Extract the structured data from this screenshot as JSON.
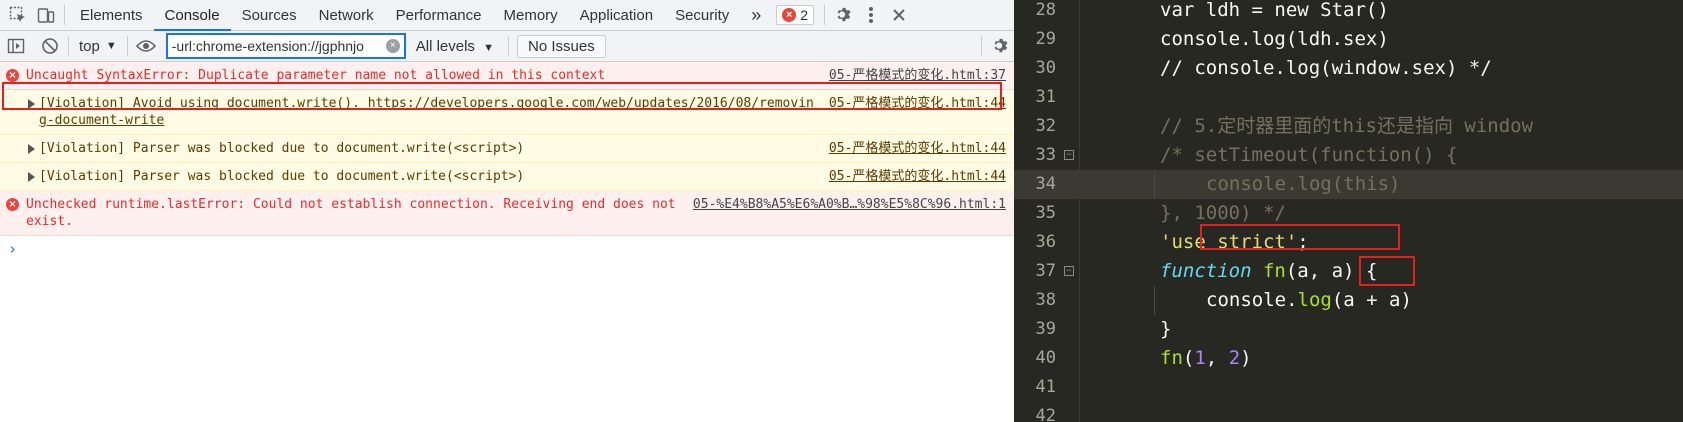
{
  "devtools": {
    "tabs": [
      "Elements",
      "Console",
      "Sources",
      "Network",
      "Performance",
      "Memory",
      "Application",
      "Security"
    ],
    "active_tab": "Console",
    "more_tabs": "»",
    "error_count": "2",
    "context": "top",
    "filter_value": "-url:chrome-extension://jgphnjo",
    "levels": "All levels",
    "issues": "No Issues",
    "messages": [
      {
        "type": "error",
        "text": "Uncaught SyntaxError: Duplicate parameter name not allowed in this context",
        "source": "05-严格模式的变化.html:37"
      },
      {
        "type": "warn",
        "text_prefix": "[Violation] Avoid using document.write(). ",
        "link": "https://developers.google.com/web/updates/2016/08/removing-document-write",
        "source": "05-严格模式的变化.html:44"
      },
      {
        "type": "warn",
        "text": "[Violation] Parser was blocked due to document.write(<script>)",
        "source": "05-严格模式的变化.html:44"
      },
      {
        "type": "warn",
        "text": "[Violation] Parser was blocked due to document.write(<script>)",
        "source": "05-严格模式的变化.html:44"
      },
      {
        "type": "error",
        "text": "Unchecked runtime.lastError: Could not establish connection. Receiving end does not exist.",
        "source": "05-%E4%B8%A5%E6%A0%B…%98%E5%8C%96.html:1"
      }
    ],
    "prompt": "›"
  },
  "editor": {
    "lines": [
      {
        "n": "28",
        "fold": false,
        "indent": 1,
        "tokens": [
          [
            "plain",
            "var ldh = new Star()"
          ]
        ]
      },
      {
        "n": "29",
        "fold": false,
        "indent": 1,
        "tokens": [
          [
            "plain",
            "console.log(ldh.sex)"
          ]
        ]
      },
      {
        "n": "30",
        "fold": false,
        "indent": 1,
        "tokens": [
          [
            "plain",
            "// console.log(window.sex) */"
          ]
        ]
      },
      {
        "n": "31",
        "fold": false,
        "indent": 0,
        "tokens": []
      },
      {
        "n": "32",
        "fold": false,
        "indent": 1,
        "tokens": [
          [
            "cm",
            "// 5.定时器里面的this还是指向 window"
          ]
        ]
      },
      {
        "n": "33",
        "fold": true,
        "indent": 1,
        "tokens": [
          [
            "cm",
            "/* setTimeout(function() {"
          ]
        ]
      },
      {
        "n": "34",
        "fold": false,
        "indent": 2,
        "tokens": [
          [
            "cm",
            "console.log(this)"
          ]
        ]
      },
      {
        "n": "35",
        "fold": false,
        "indent": 1,
        "tokens": [
          [
            "cm",
            "}, 1000) */"
          ]
        ]
      },
      {
        "n": "36",
        "fold": false,
        "indent": 1,
        "tokens": [
          [
            "str",
            "'use strict'"
          ],
          [
            "plain",
            ";"
          ]
        ]
      },
      {
        "n": "37",
        "fold": true,
        "indent": 1,
        "tokens": [
          [
            "kw",
            "function"
          ],
          [
            "plain",
            " "
          ],
          [
            "fn",
            "fn"
          ],
          [
            "plain",
            "(a, a) {"
          ]
        ]
      },
      {
        "n": "38",
        "fold": false,
        "indent": 2,
        "tokens": [
          [
            "plain",
            "console."
          ],
          [
            "fn",
            "log"
          ],
          [
            "plain",
            "(a + a)"
          ]
        ]
      },
      {
        "n": "39",
        "fold": false,
        "indent": 1,
        "tokens": [
          [
            "plain",
            "}"
          ]
        ]
      },
      {
        "n": "40",
        "fold": false,
        "indent": 1,
        "tokens": [
          [
            "fn",
            "fn"
          ],
          [
            "plain",
            "("
          ],
          [
            "num",
            "1"
          ],
          [
            "plain",
            ", "
          ],
          [
            "num",
            "2"
          ],
          [
            "plain",
            ")"
          ]
        ]
      },
      {
        "n": "41",
        "fold": false,
        "indent": 0,
        "tokens": []
      },
      {
        "n": "42",
        "fold": false,
        "indent": 0,
        "tokens": []
      }
    ]
  },
  "colors": {
    "error_red": "#e32d2d",
    "highlight_box": "#e3201b",
    "accent_blue": "#1a73e8",
    "editor_bg": "#272822"
  }
}
